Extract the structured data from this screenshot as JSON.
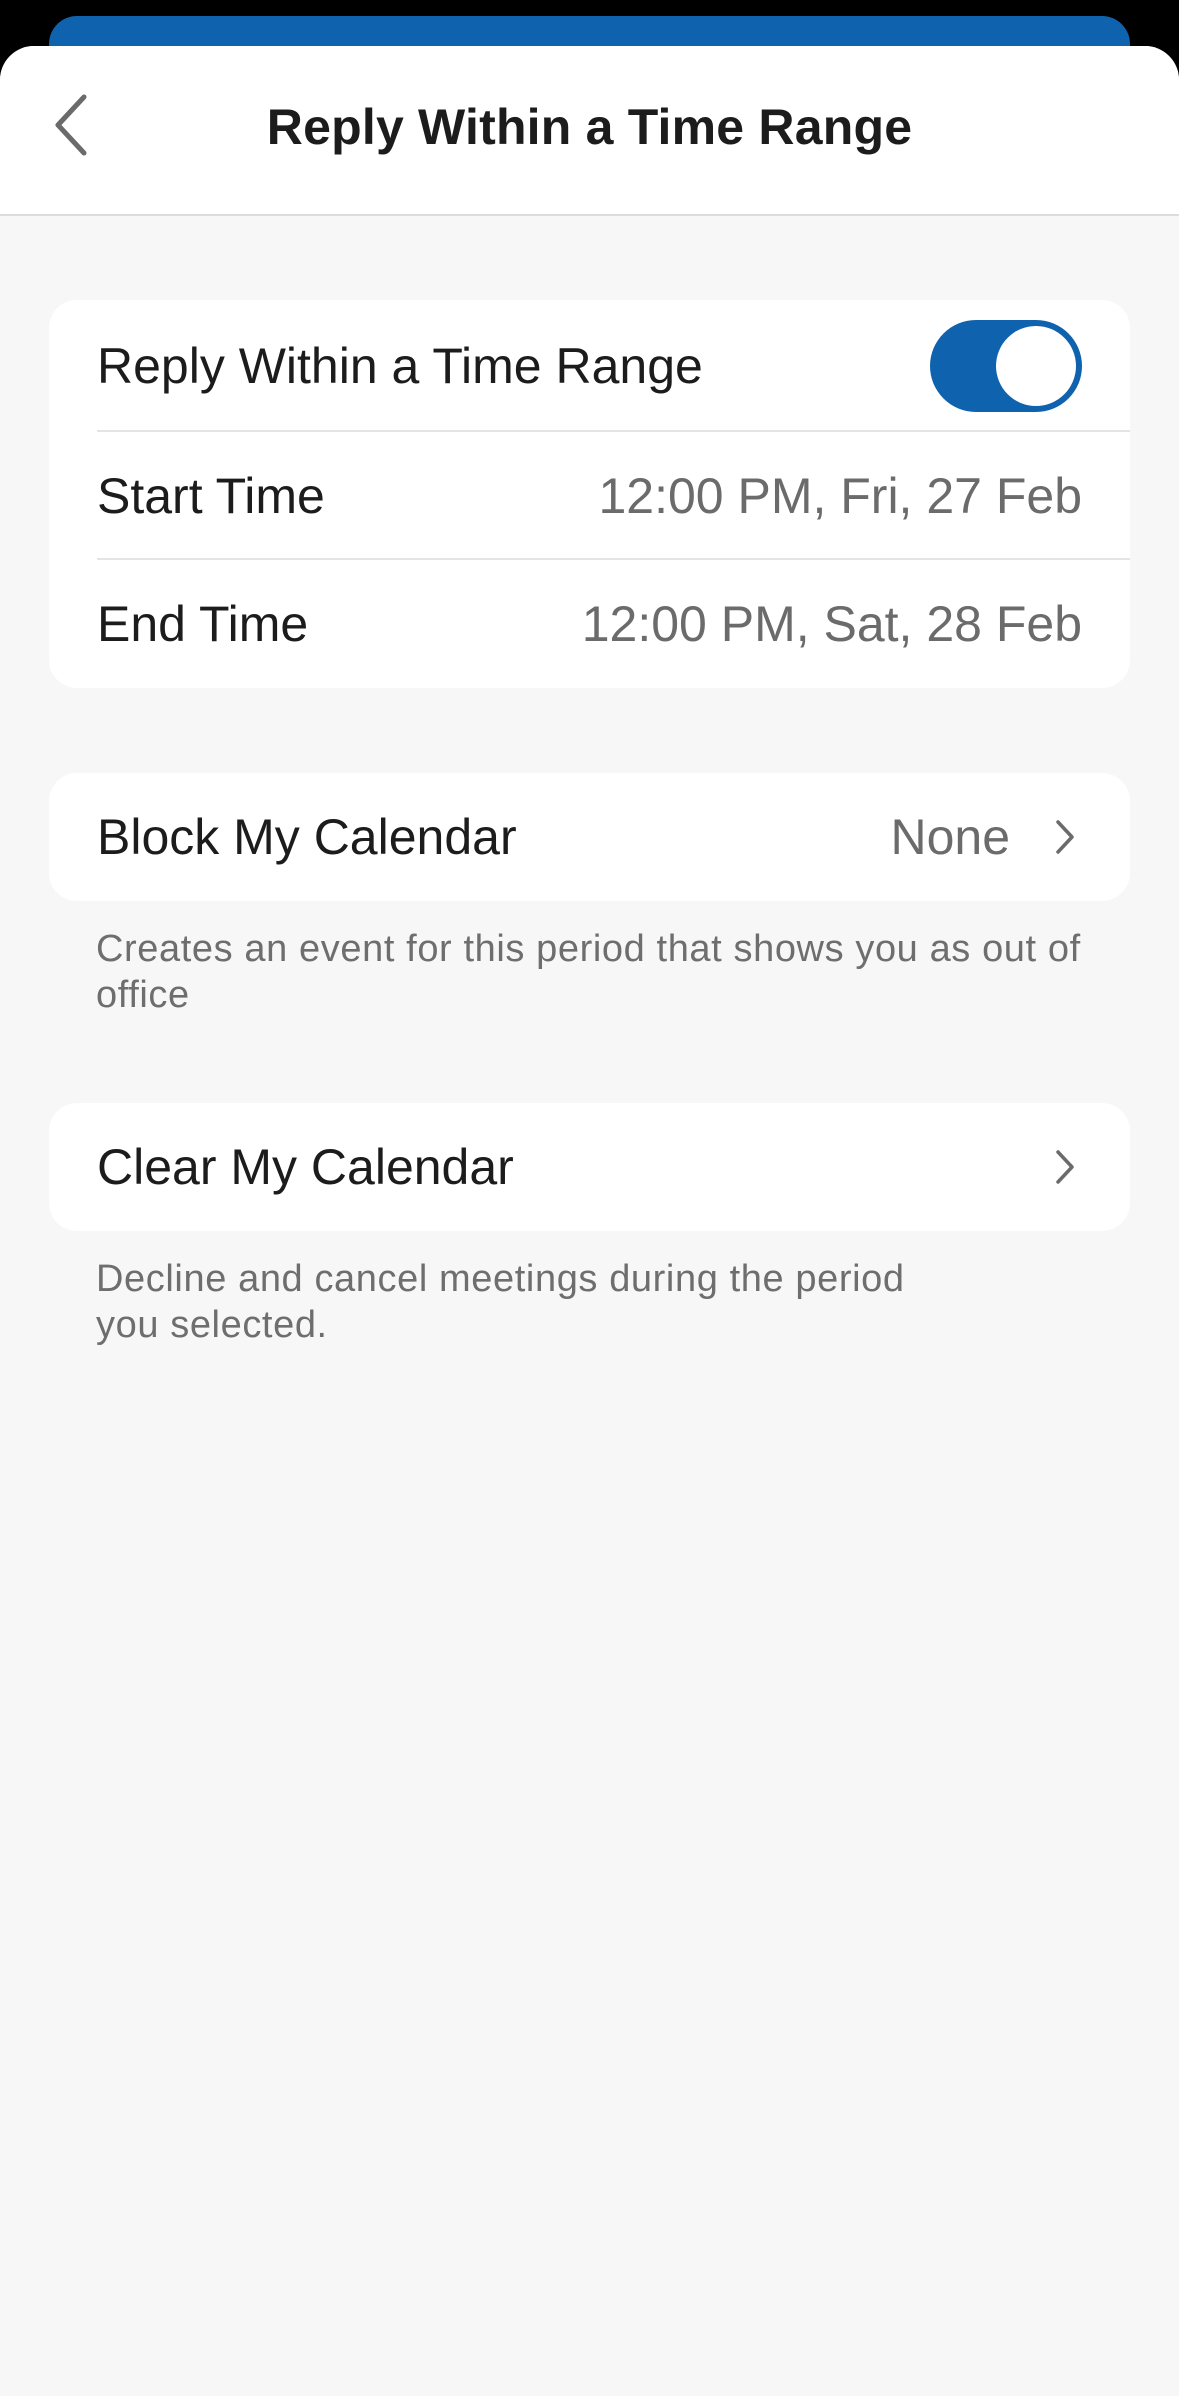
{
  "header": {
    "title": "Reply Within a Time Range",
    "back_icon": "chevron-left-icon"
  },
  "time_range_section": {
    "toggle_label": "Reply Within a Time Range",
    "toggle_state": "on",
    "start_label": "Start Time",
    "start_value": "12:00 PM, Fri, 27 Feb",
    "end_label": "End Time",
    "end_value": "12:00 PM, Sat, 28 Feb"
  },
  "block_calendar": {
    "label": "Block My Calendar",
    "value": "None",
    "chevron_icon": "chevron-right-icon",
    "footnote": "Creates an event for this period that shows you as out of office"
  },
  "clear_calendar": {
    "label": "Clear My Calendar",
    "chevron_icon": "chevron-right-icon",
    "footnote": "Decline and cancel meetings during the period you selected."
  },
  "colors": {
    "accent": "#0f62ad",
    "background": "#f7f7f7",
    "card": "#ffffff",
    "primary_text": "#1c1c1c",
    "secondary_text": "#6b6b6b"
  }
}
